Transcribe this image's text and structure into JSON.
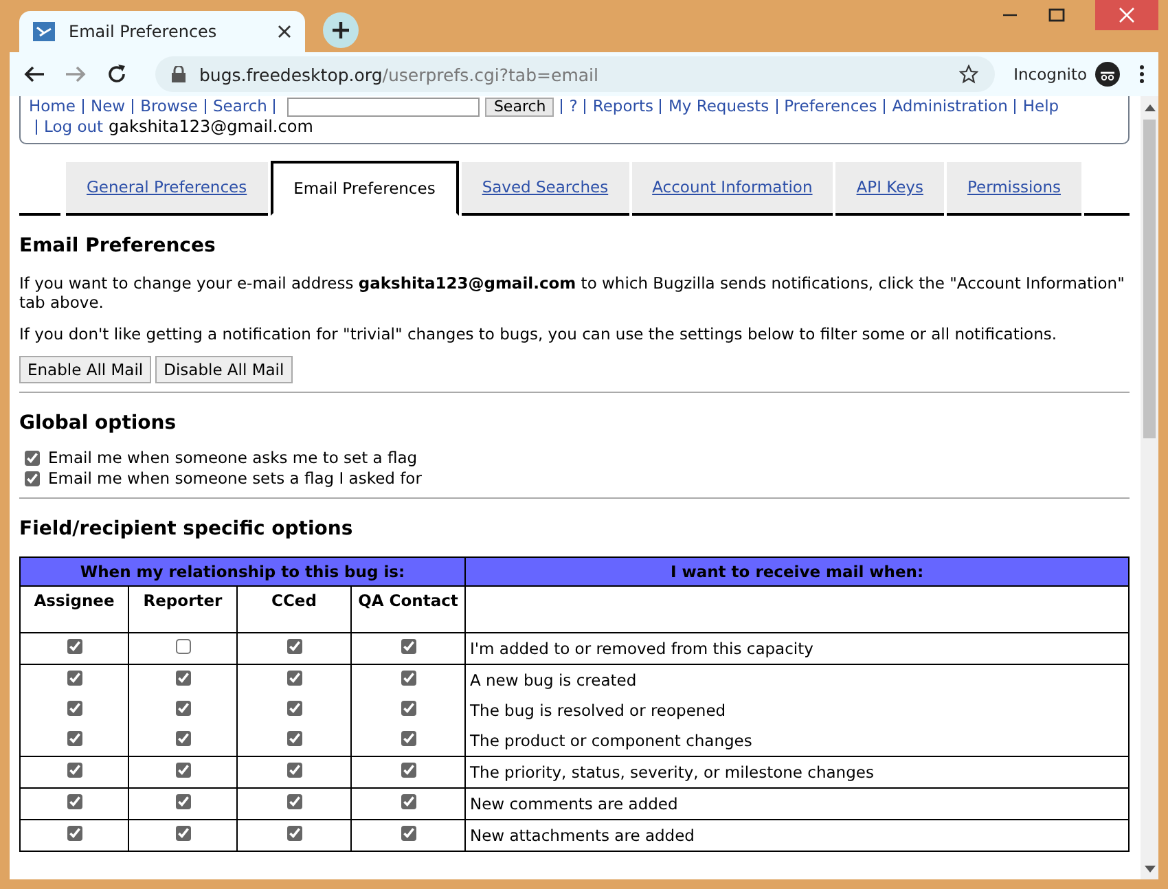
{
  "window": {
    "title": "Email Preferences"
  },
  "browser": {
    "url_host": "bugs.freedesktop.org",
    "url_path": "/userprefs.cgi?tab=email",
    "profile_label": "Incognito"
  },
  "nav": {
    "links_before": [
      "Home",
      "New",
      "Browse",
      "Search"
    ],
    "search_button": "Search",
    "links_after": [
      "?",
      "Reports",
      "My Requests",
      "Preferences",
      "Administration",
      "Help"
    ],
    "logout_link": "Log out",
    "user": "gakshita123@gmail.com"
  },
  "tabs": [
    {
      "label": "General Preferences",
      "selected": false
    },
    {
      "label": "Email Preferences",
      "selected": true
    },
    {
      "label": "Saved Searches",
      "selected": false
    },
    {
      "label": "Account Information",
      "selected": false
    },
    {
      "label": "API Keys",
      "selected": false
    },
    {
      "label": "Permissions",
      "selected": false
    }
  ],
  "heading": "Email Preferences",
  "paragraphs": [
    "If you want to change your e-mail address **gakshita123@gmail.com** to which Bugzilla sends notifications, click the \"Account Information\" tab above.",
    "If you don't like getting a notification for \"trivial\" changes to bugs, you can use the settings below to filter some or all notifications."
  ],
  "buttons": [
    "Enable All Mail",
    "Disable All Mail"
  ],
  "global_options": {
    "heading": "Global options",
    "options": [
      {
        "label": "Email me when someone asks me to set a flag",
        "checked": true
      },
      {
        "label": "Email me when someone sets a flag I asked for",
        "checked": true
      }
    ]
  },
  "field_options": {
    "heading": "Field/recipient specific options",
    "header_left": "When my relationship to this bug is:",
    "header_right": "I want to receive mail when:",
    "columns": [
      "Assignee",
      "Reporter",
      "CCed",
      "QA Contact"
    ],
    "groups": [
      {
        "rows": [
          {
            "event": "I'm added to or removed from this capacity",
            "checks": [
              true,
              false,
              true,
              true
            ]
          }
        ]
      },
      {
        "rows": [
          {
            "event": "A new bug is created",
            "checks": [
              true,
              true,
              true,
              true
            ]
          },
          {
            "event": "The bug is resolved or reopened",
            "checks": [
              true,
              true,
              true,
              true
            ]
          },
          {
            "event": "The product or component changes",
            "checks": [
              true,
              true,
              true,
              true
            ]
          }
        ]
      },
      {
        "rows": [
          {
            "event": "The priority, status, severity, or milestone changes",
            "checks": [
              true,
              true,
              true,
              true
            ]
          }
        ]
      },
      {
        "rows": [
          {
            "event": "New comments are added",
            "checks": [
              true,
              true,
              true,
              true
            ]
          }
        ]
      },
      {
        "rows": [
          {
            "event": "New attachments are added",
            "checks": [
              true,
              true,
              true,
              true
            ]
          }
        ]
      }
    ]
  }
}
